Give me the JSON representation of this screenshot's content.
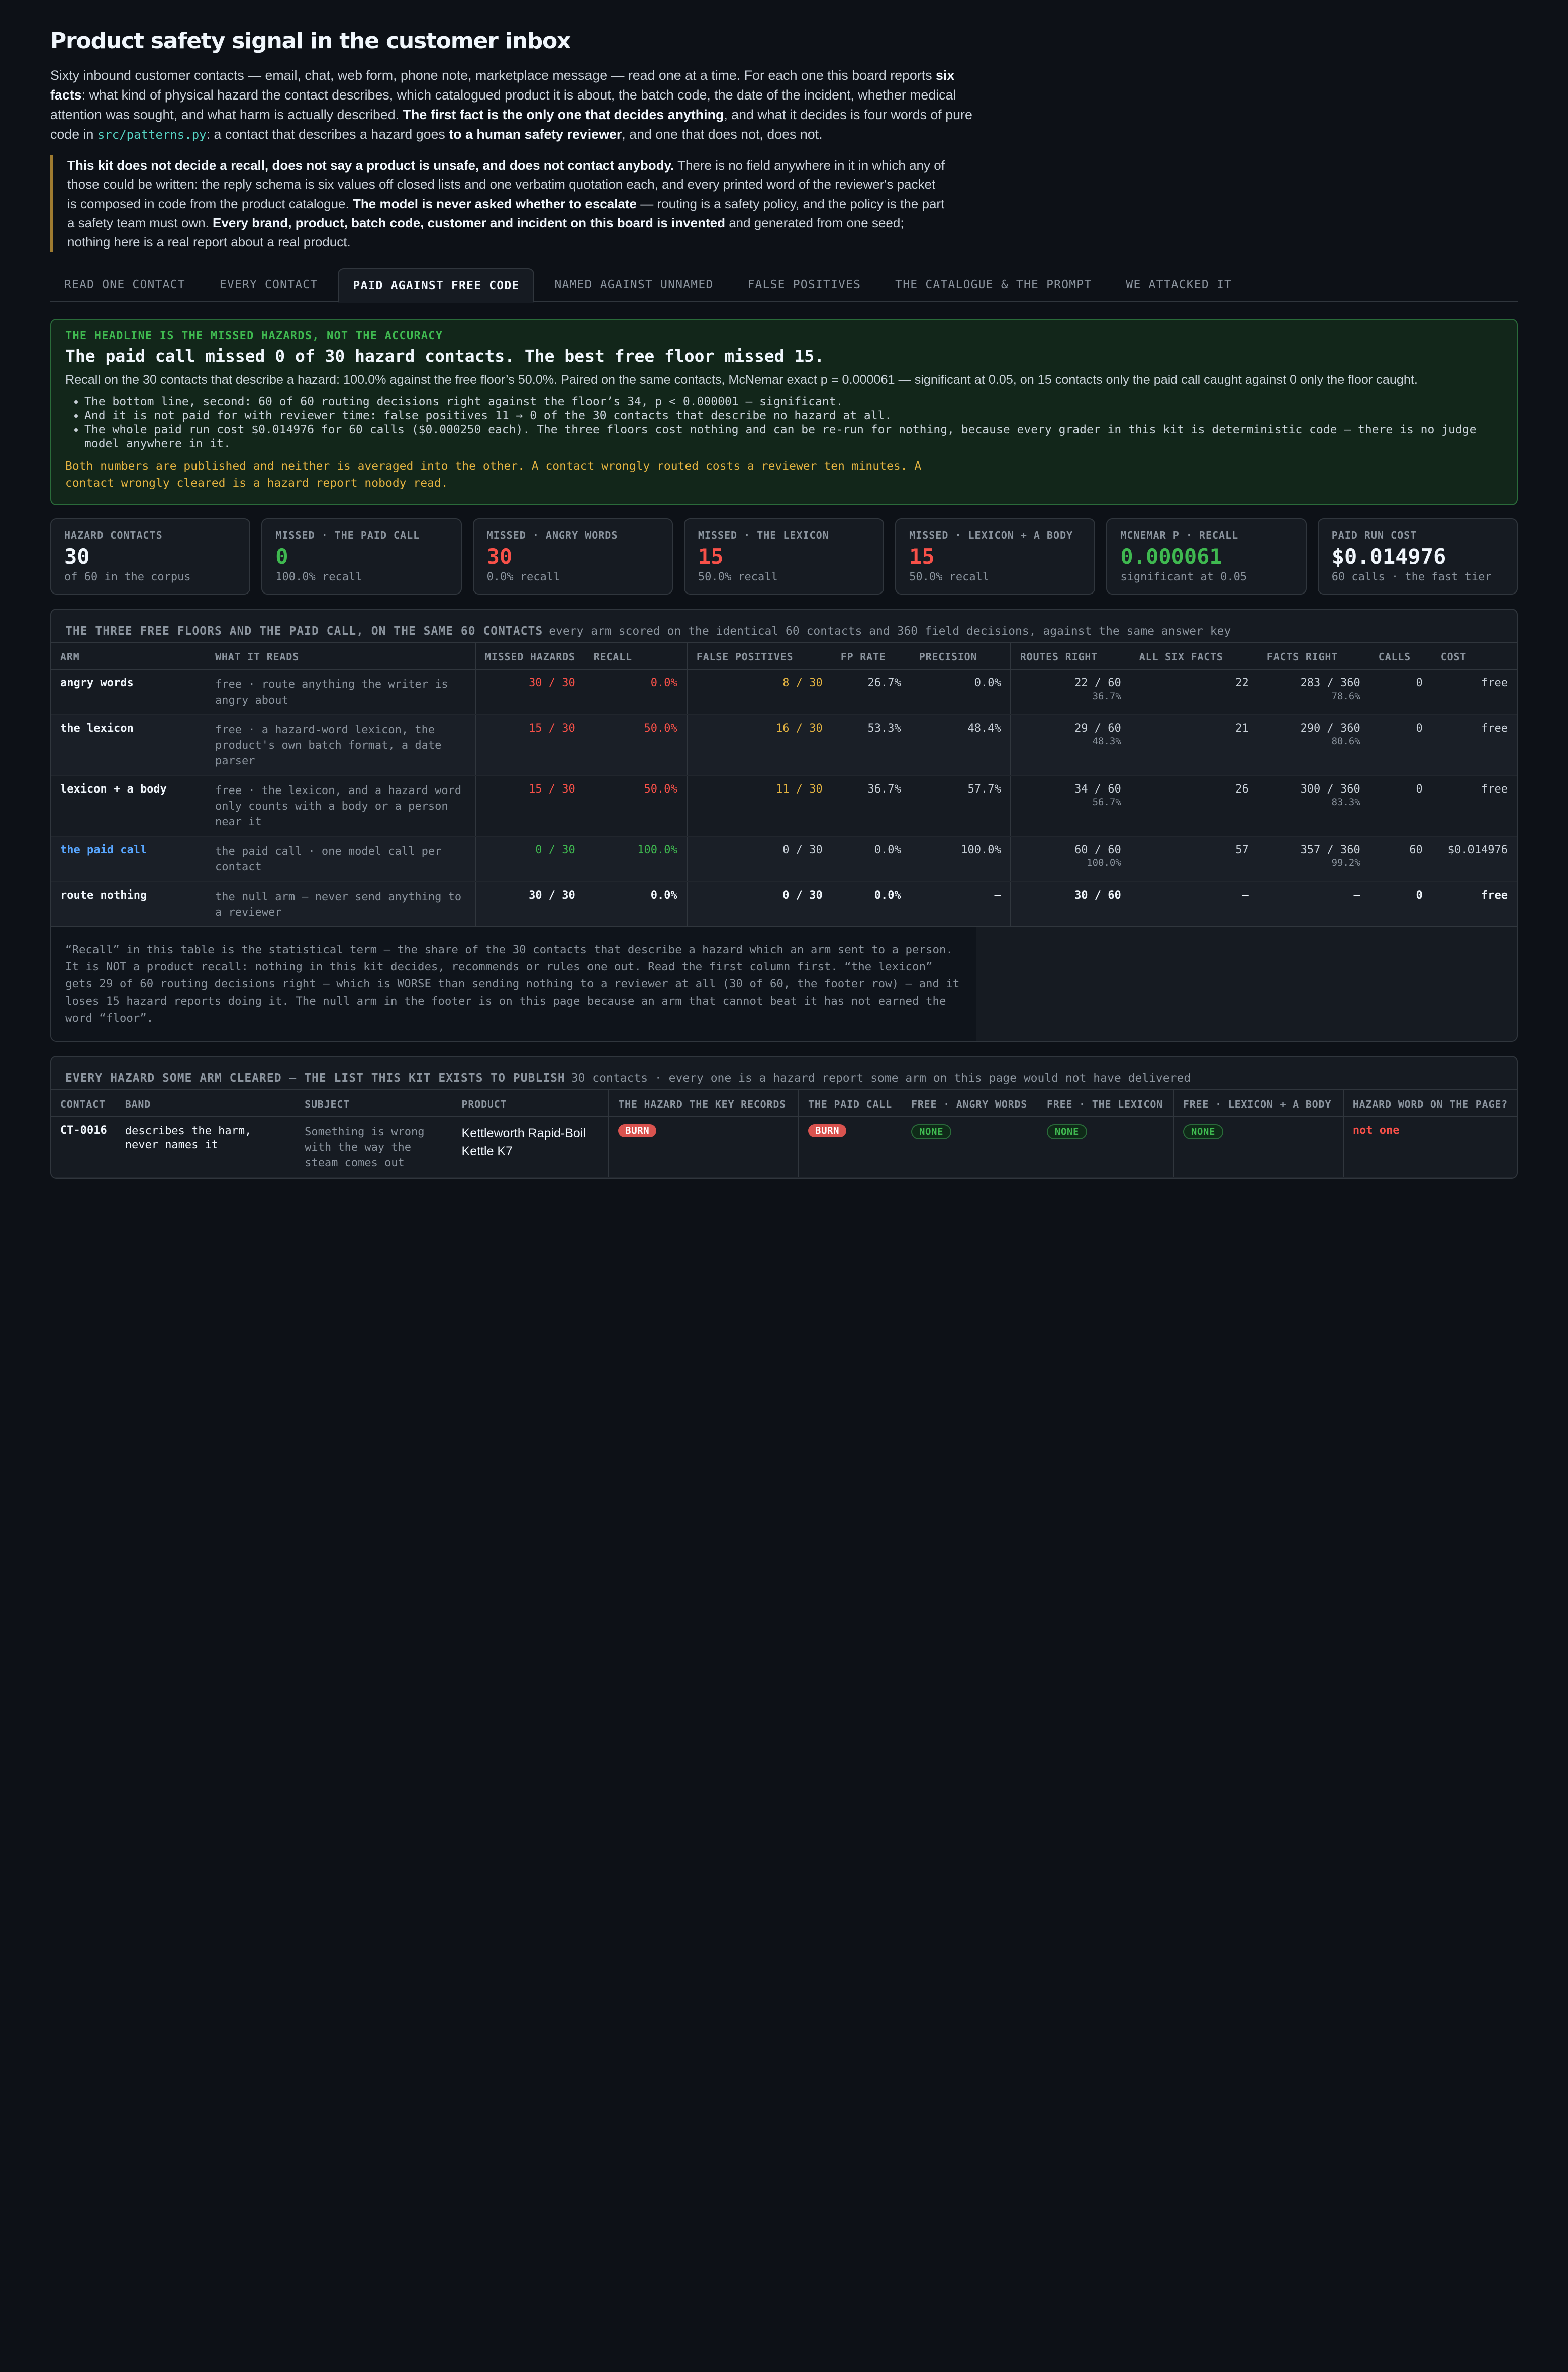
{
  "page": {
    "title": "Product safety signal in the customer inbox",
    "intro": {
      "p1": "Sixty inbound customer contacts — email, chat, web form, phone note, marketplace message — read one at a time. For each one this board reports ",
      "b1": "six facts",
      "p2": ": what kind of physical hazard the contact describes, which catalogued product it is about, the batch code, the date of the incident, whether medical attention was sought, and what harm is actually described. ",
      "b2": "The first fact is the only one that decides anything",
      "p3": ", and what it decides is four words of pure code in ",
      "code": "src/patterns.py",
      "p4": ": a contact that describes a hazard goes ",
      "b3": "to a human safety reviewer",
      "p5": ", and one that does not, does not."
    },
    "callout": {
      "b1": "This kit does not decide a recall, does not say a product is unsafe, and does not contact anybody.",
      "p1": " There is no field anywhere in it in which any of those could be written: the reply schema is six values off closed lists and one verbatim quotation each, and every printed word of the reviewer's packet is composed in code from the product catalogue. ",
      "b2": "The model is never asked whether to escalate",
      "p2": " — routing is a safety policy, and the policy is the part a safety team must own. ",
      "b3": "Every brand, product, batch code, customer and incident on this board is invented",
      "p3": " and generated from one seed; nothing here is a real report about a real product."
    }
  },
  "tabs": [
    {
      "label": "READ ONE CONTACT"
    },
    {
      "label": "EVERY CONTACT"
    },
    {
      "label": "PAID AGAINST FREE CODE"
    },
    {
      "label": "NAMED AGAINST UNNAMED"
    },
    {
      "label": "FALSE POSITIVES"
    },
    {
      "label": "THE CATALOGUE & THE PROMPT"
    },
    {
      "label": "WE ATTACKED IT"
    }
  ],
  "headline": {
    "kicker": "THE HEADLINE IS THE MISSED HAZARDS, NOT THE ACCURACY",
    "title": "The paid call missed 0 of 30 hazard contacts. The best free floor missed 15.",
    "para": "Recall on the 30 contacts that describe a hazard: 100.0% against the free floor’s 50.0%. Paired on the same contacts, McNemar exact p = 0.000061 — significant at 0.05, on 15 contacts only the paid call caught against 0 only the floor caught.",
    "bullets": [
      "The bottom line, second: 60 of 60 routing decisions right against the floor’s 34, p < 0.000001 — significant.",
      "And it is not paid for with reviewer time: false positives 11 → 0 of the 30 contacts that describe no hazard at all.",
      "The whole paid run cost $0.014976 for 60 calls ($0.000250 each). The three floors cost nothing and can be re-run for nothing, because every grader in this kit is deterministic code — there is no judge model anywhere in it."
    ],
    "warn": "Both numbers are published and neither is averaged into the other. A contact wrongly routed costs a reviewer ten minutes. A contact wrongly cleared is a hazard report nobody read."
  },
  "stats": [
    {
      "label": "HAZARD CONTACTS",
      "value": "30",
      "sub": "of 60 in the corpus",
      "color": "#f0f6fc"
    },
    {
      "label": "MISSED · THE PAID CALL",
      "value": "0",
      "sub": "100.0% recall",
      "color": "#3fb950"
    },
    {
      "label": "MISSED · ANGRY WORDS",
      "value": "30",
      "sub": "0.0% recall",
      "color": "#f85149"
    },
    {
      "label": "MISSED · THE LEXICON",
      "value": "15",
      "sub": "50.0% recall",
      "color": "#f85149"
    },
    {
      "label": "MISSED · LEXICON + A BODY",
      "value": "15",
      "sub": "50.0% recall",
      "color": "#f85149"
    },
    {
      "label": "MCNEMAR P · RECALL",
      "value": "0.000061",
      "sub": "significant at 0.05",
      "color": "#3fb950"
    },
    {
      "label": "PAID RUN COST",
      "value": "$0.014976",
      "sub": "60 calls · the fast tier",
      "color": "#f0f6fc"
    }
  ],
  "arms_table": {
    "title": "THE THREE FREE FLOORS AND THE PAID CALL, ON THE SAME 60 CONTACTS",
    "subtitle": "every arm scored on the identical 60 contacts and 360 field decisions, against the same answer key",
    "headers": [
      "ARM",
      "WHAT IT READS",
      "MISSED HAZARDS",
      "RECALL",
      "FALSE POSITIVES",
      "FP RATE",
      "PRECISION",
      "ROUTES RIGHT",
      "ALL SIX FACTS",
      "FACTS RIGHT",
      "CALLS",
      "COST"
    ],
    "rows": [
      {
        "arm": "angry words",
        "reads": "free · route anything the writer is angry about",
        "missed": "30 / 30",
        "recall": "0.0%",
        "fp": "8 / 30",
        "fp_rate": "26.7%",
        "precision": "0.0%",
        "routes": "22 / 60",
        "routes_pct": "36.7%",
        "all_six": "22",
        "facts": "283 / 360",
        "facts_pct": "78.6%",
        "calls": "0",
        "cost": "free"
      },
      {
        "arm": "the lexicon",
        "reads": "free · a hazard-word lexicon, the product's own batch format, a date parser",
        "missed": "15 / 30",
        "recall": "50.0%",
        "fp": "16 / 30",
        "fp_rate": "53.3%",
        "precision": "48.4%",
        "routes": "29 / 60",
        "routes_pct": "48.3%",
        "all_six": "21",
        "facts": "290 / 360",
        "facts_pct": "80.6%",
        "calls": "0",
        "cost": "free"
      },
      {
        "arm": "lexicon + a body",
        "reads": "free · the lexicon, and a hazard word only counts with a body or a person near it",
        "missed": "15 / 30",
        "recall": "50.0%",
        "fp": "11 / 30",
        "fp_rate": "36.7%",
        "precision": "57.7%",
        "routes": "34 / 60",
        "routes_pct": "56.7%",
        "all_six": "26",
        "facts": "300 / 360",
        "facts_pct": "83.3%",
        "calls": "0",
        "cost": "free"
      },
      {
        "arm": "the paid call",
        "reads": "the paid call · one model call per contact",
        "missed": "0 / 30",
        "recall": "100.0%",
        "fp": "0 / 30",
        "fp_rate": "0.0%",
        "precision": "100.0%",
        "routes": "60 / 60",
        "routes_pct": "100.0%",
        "all_six": "57",
        "facts": "357 / 360",
        "facts_pct": "99.2%",
        "calls": "60",
        "cost": "$0.014976"
      }
    ],
    "footer": {
      "arm": "route nothing",
      "reads": "the null arm — never send anything to a reviewer",
      "missed": "30 / 30",
      "recall": "0.0%",
      "fp": "0 / 30",
      "fp_rate": "0.0%",
      "precision": "—",
      "routes": "30 / 60",
      "all_six": "—",
      "facts": "—",
      "calls": "0",
      "cost": "free"
    },
    "note": "“Recall” in this table is the statistical term — the share of the 30 contacts that describe a hazard which an arm sent to a person. It is NOT a product recall: nothing in this kit decides, recommends or rules one out. Read the first column first. “the lexicon” gets 29 of 60 routing decisions right — which is WORSE than sending nothing to a reviewer at all (30 of 60, the footer row) — and it loses 15 hazard reports doing it. The null arm in the footer is on this page because an arm that cannot beat it has not earned the word “floor”."
  },
  "cleared_table": {
    "title": "EVERY HAZARD SOME ARM CLEARED — THE LIST THIS KIT EXISTS TO PUBLISH",
    "subtitle": "30 contacts · every one is a hazard report some arm on this page would not have delivered",
    "headers": [
      "CONTACT",
      "BAND",
      "SUBJECT",
      "PRODUCT",
      "THE HAZARD THE KEY RECORDS",
      "THE PAID CALL",
      "FREE · ANGRY WORDS",
      "FREE · THE LEXICON",
      "FREE · LEXICON + A BODY",
      "HAZARD WORD ON THE PAGE?"
    ],
    "rows": [
      {
        "contact": "CT-0016",
        "band": "describes the harm, never names it",
        "subject": "Something is wrong with the way the steam comes out",
        "product": "Kettleworth Rapid-Boil Kettle K7",
        "key_hazard": "BURN",
        "paid": "BURN",
        "angry": "NONE",
        "lexicon": "NONE",
        "lexicon_body": "NONE",
        "hazard_word": "not one"
      }
    ]
  }
}
